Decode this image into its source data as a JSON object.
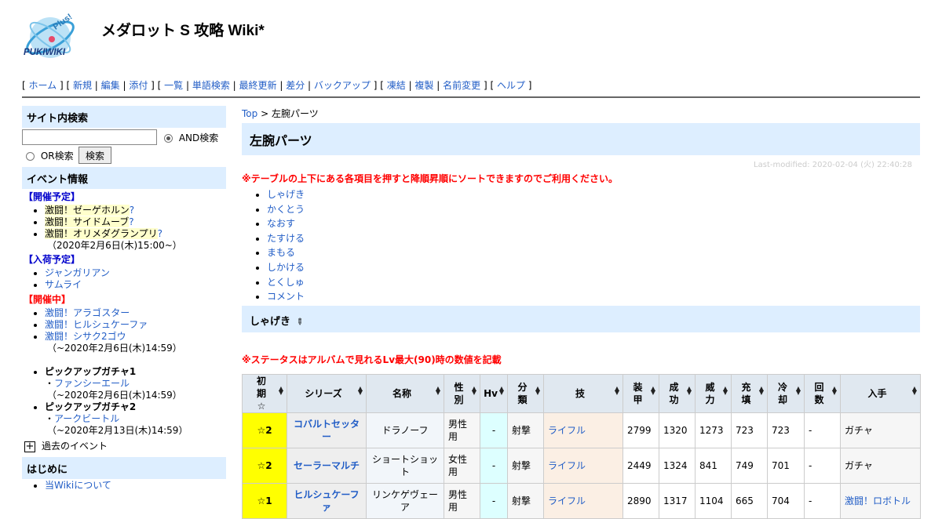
{
  "site": {
    "title": "メダロット S 攻略 Wiki*",
    "logo_text": "PUKIWIKI",
    "logo_plus": "Plus!"
  },
  "nav": {
    "groups": [
      [
        "ホーム"
      ],
      [
        "新規",
        "編集",
        "添付"
      ],
      [
        "一覧",
        "単語検索",
        "最終更新",
        "差分",
        "バックアップ"
      ],
      [
        "凍結",
        "複製",
        "名前変更"
      ],
      [
        "ヘルプ"
      ]
    ]
  },
  "sidebar": {
    "search": {
      "heading": "サイト内検索",
      "and_label": "AND検索",
      "or_label": "OR検索",
      "button": "検索",
      "value": ""
    },
    "events": {
      "heading": "イベント情報",
      "scheduled_label": "【開催予定】",
      "scheduled": [
        "激闘！ゼーゲホルン",
        "激闘！サイドムーブ",
        "激闘！オリメダグランプリ"
      ],
      "scheduled_note": "（2020年2月6日(木)15:00~）",
      "arrival_label": "【入荷予定】",
      "arrival": [
        "ジャンガリアン",
        "サムライ"
      ],
      "live_label": "【開催中】",
      "live": [
        "激闘！アラゴスター",
        "激闘！ヒルシュケーファ",
        "激闘！シサク2ゴウ"
      ],
      "live_note": "（~2020年2月6日(木)14:59）",
      "gacha1": {
        "title": "ピックアップガチャ1",
        "item": "ファンシーエール",
        "note": "（~2020年2月6日(木)14:59）"
      },
      "gacha2": {
        "title": "ピックアップガチャ2",
        "item": "アークビートル",
        "note": "（~2020年2月13日(木)14:59）"
      },
      "past": "過去のイベント"
    },
    "intro": {
      "heading": "はじめに",
      "item": "当Wikiについて"
    }
  },
  "main": {
    "breadcrumb_top": "Top",
    "breadcrumb_sep": " > ",
    "breadcrumb_current": "左腕パーツ",
    "title": "左腕パーツ",
    "last_modified": "Last-modified: 2020-02-04 (火) 22:40:28",
    "note1": "※テーブルの上下にある各項目を押すと降順昇順にソートできますのでご利用ください。",
    "toc": [
      "しゃげき",
      "かくとう",
      "なおす",
      "たすける",
      "まもる",
      "しかける",
      "とくしゅ",
      "コメント"
    ],
    "section": "しゃげき",
    "note2": "※ステータスはアルバムで見れるLv最大(90)時の数値を記載",
    "table": {
      "headers": [
        "初期☆",
        "シリーズ",
        "名称",
        "性別",
        "Hv",
        "分類",
        "技",
        "装甲",
        "成功",
        "威力",
        "充填",
        "冷却",
        "回数",
        "入手"
      ],
      "rows": [
        [
          "☆2",
          "コバルトセッター",
          "ドラノーフ",
          "男性用",
          "-",
          "射撃",
          "ライフル",
          "2799",
          "1320",
          "1273",
          "723",
          "723",
          "-",
          "ガチャ"
        ],
        [
          "☆2",
          "セーラーマルチ",
          "ショートショット",
          "女性用",
          "-",
          "射撃",
          "ライフル",
          "2449",
          "1324",
          "841",
          "749",
          "701",
          "-",
          "ガチャ"
        ],
        [
          "☆1",
          "ヒルシュケーファ",
          "リンケゲヴェーア",
          "男性用",
          "-",
          "射撃",
          "ライフル",
          "2890",
          "1317",
          "1104",
          "665",
          "704",
          "-",
          "激闘！ロボトル"
        ]
      ]
    }
  },
  "colors": {
    "accent": "#ddeeff",
    "link": "#215dc6",
    "note": "#ff0000",
    "rarity": "#ffff00"
  }
}
